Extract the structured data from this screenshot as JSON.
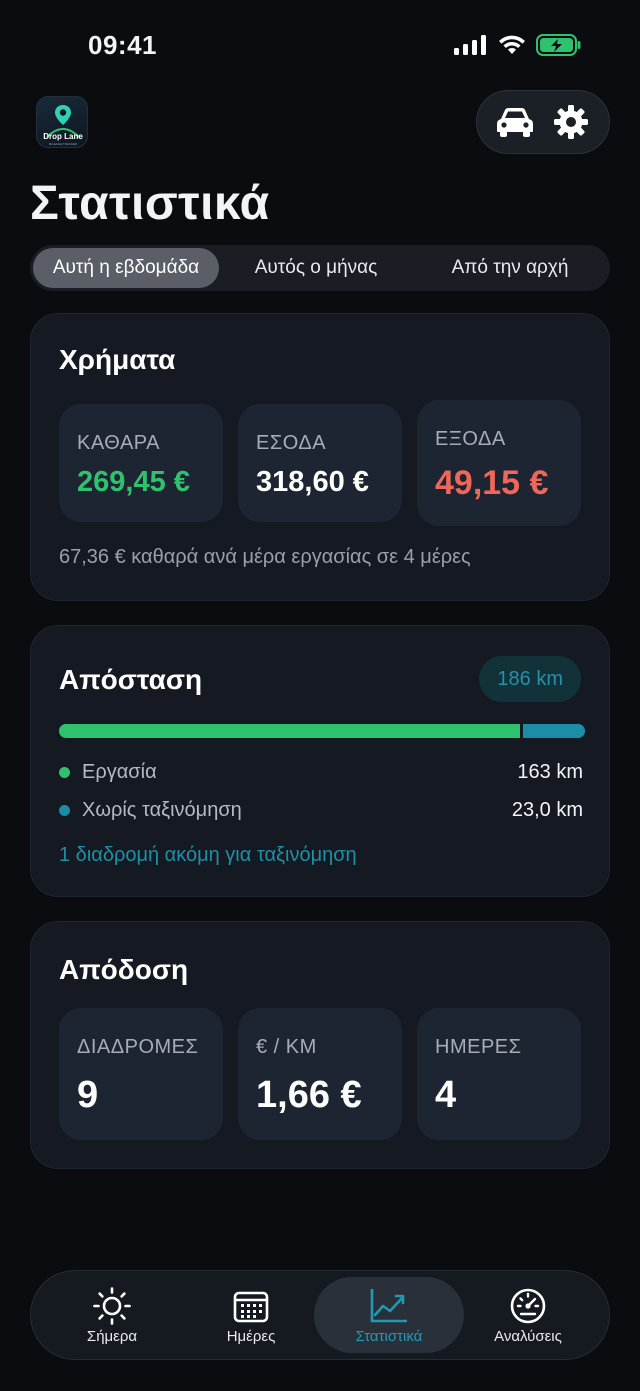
{
  "status_bar": {
    "time": "09:41"
  },
  "header": {
    "logo_text": "Drop Lane",
    "logo_subtext": "MILEAGE TRACKER",
    "actions": [
      {
        "icon": "car-icon"
      },
      {
        "icon": "gear-icon"
      }
    ]
  },
  "page_title": "Στατιστικά",
  "periods": {
    "selected": "Αυτή η εβδομάδα",
    "items": [
      "Αυτή η εβδομάδα",
      "Αυτός ο μήνας",
      "Από την αρχή"
    ]
  },
  "money": {
    "title": "Χρήματα",
    "tiles": [
      {
        "label": "ΚΑΘΑΡΑ",
        "value": "269,45 €",
        "color": "#2fc26e"
      },
      {
        "label": "ΕΣΟΔΑ",
        "value": "318,60 €",
        "color": "#ffffff"
      },
      {
        "label": "ΕΞΟΔΑ",
        "value": "49,15 €",
        "color": "#f0675a"
      }
    ],
    "note": "67,36 € καθαρά ανά μέρα εργασίας σε 4 μέρες"
  },
  "distance": {
    "title": "Απόσταση",
    "total": "186 km",
    "work_fraction": 0.876,
    "colors": {
      "work": "#2fc26e",
      "unclassified": "#1c8da6"
    },
    "rows": [
      {
        "label": "Εργασία",
        "value": "163 km"
      },
      {
        "label": "Χωρίς ταξινόμηση",
        "value": "23,0 km"
      }
    ],
    "link": "1 διαδρομή ακόμη για ταξινόμηση"
  },
  "performance": {
    "title": "Απόδοση",
    "tiles": [
      {
        "label": "ΔΙΑΔΡΟΜΕΣ",
        "value": "9"
      },
      {
        "label": "€ / KM",
        "value": "1,66 €"
      },
      {
        "label": "ΗΜΕΡΕΣ",
        "value": "4"
      }
    ]
  },
  "tabbar": {
    "items": [
      {
        "label": "Σήμερα",
        "icon": "sun-icon"
      },
      {
        "label": "Ημέρες",
        "icon": "calendar-icon"
      },
      {
        "label": "Στατιστικά",
        "icon": "chart-icon"
      },
      {
        "label": "Αναλύσεις",
        "icon": "gauge-icon"
      }
    ],
    "active": "Στατιστικά",
    "accent": "#1f9ab4"
  }
}
